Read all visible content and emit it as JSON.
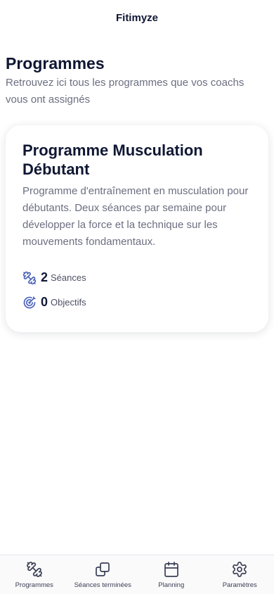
{
  "app": {
    "title": "Fitimyze"
  },
  "page": {
    "title": "Programmes",
    "subtitle": "Retrouvez ici tous les programmes que vos coachs vous ont assignés"
  },
  "program": {
    "title": "Programme Musculation Débutant",
    "description": "Programme d'entraînement en musculation pour débutants. Deux séances par semaine pour développer la force et la technique sur les mouvements fondamentaux.",
    "sessions_count": "2",
    "sessions_label": "Séances",
    "goals_count": "0",
    "goals_label": "Objectifs"
  },
  "nav": {
    "items": [
      {
        "label": "Programmes",
        "icon": "dumbbell-icon"
      },
      {
        "label": "Séances terminées",
        "icon": "copy-icon"
      },
      {
        "label": "Planning",
        "icon": "calendar-icon"
      },
      {
        "label": "Paramètres",
        "icon": "gear-icon"
      }
    ]
  },
  "colors": {
    "accent": "#4a63b8",
    "text_dark": "#0f1733",
    "text_muted": "#6b6f80",
    "nav_icon": "#3a3f55"
  }
}
